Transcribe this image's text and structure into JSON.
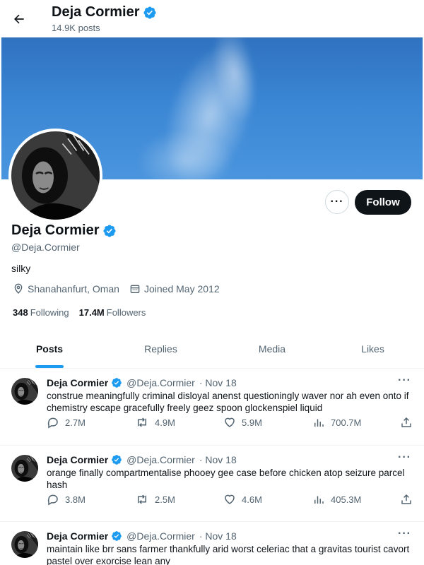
{
  "header": {
    "name": "Deja Cormier",
    "posts_count": "14.9K posts"
  },
  "profile": {
    "name": "Deja Cormier",
    "handle": "@Deja.Cormier",
    "bio": "silky",
    "location": "Shanahanfurt, Oman",
    "joined": "Joined May 2012",
    "following_count": "348",
    "following_label": "Following",
    "followers_count": "17.4M",
    "followers_label": "Followers",
    "follow_label": "Follow",
    "more_label": "···"
  },
  "tabs": [
    {
      "label": "Posts",
      "active": true
    },
    {
      "label": "Replies",
      "active": false
    },
    {
      "label": "Media",
      "active": false
    },
    {
      "label": "Likes",
      "active": false
    }
  ],
  "tweets": [
    {
      "name": "Deja Cormier",
      "handle": "@Deja.Cormier",
      "date": "· Nov 18",
      "text": "construe meaningfully criminal disloyal anenst questioningly waver nor ah even onto if chemistry escape gracefully freely geez spoon glockenspiel liquid",
      "replies": "2.7M",
      "reposts": "4.9M",
      "likes": "5.9M",
      "views": "700.7M"
    },
    {
      "name": "Deja Cormier",
      "handle": "@Deja.Cormier",
      "date": "· Nov 18",
      "text": "orange finally compartmentalise phooey gee case before chicken atop seizure parcel hash",
      "replies": "3.8M",
      "reposts": "2.5M",
      "likes": "4.6M",
      "views": "405.3M"
    },
    {
      "name": "Deja Cormier",
      "handle": "@Deja.Cormier",
      "date": "· Nov 18",
      "text": "maintain like brr sans farmer thankfully arid worst celeriac that a gravitas tourist cavort pastel over exorcise lean any",
      "replies": "",
      "reposts": "",
      "likes": "",
      "views": ""
    }
  ],
  "colors": {
    "accent": "#1d9bf0",
    "text": "#0f1419",
    "muted": "#536471",
    "verified": "#1d9bf0",
    "follow_bg": "#0f1419"
  }
}
